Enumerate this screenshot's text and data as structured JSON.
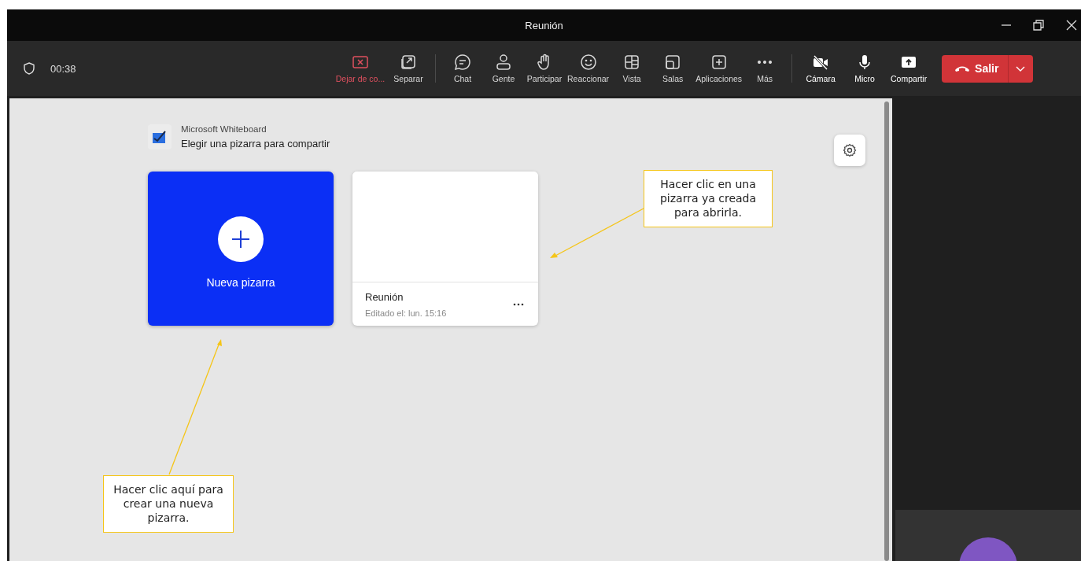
{
  "window": {
    "title": "Reunión"
  },
  "meeting_bar": {
    "timer": "00:38",
    "actions": [
      {
        "label": "Dejar de co...",
        "kind": "stop"
      },
      {
        "label": "Separar",
        "kind": "normal"
      },
      {
        "label": "Chat",
        "kind": "normal"
      },
      {
        "label": "Gente",
        "kind": "normal"
      },
      {
        "label": "Participar",
        "kind": "normal"
      },
      {
        "label": "Reaccionar",
        "kind": "normal"
      },
      {
        "label": "Vista",
        "kind": "normal"
      },
      {
        "label": "Salas",
        "kind": "normal"
      },
      {
        "label": "Aplicaciones",
        "kind": "normal"
      },
      {
        "label": "Más",
        "kind": "normal"
      }
    ],
    "devices": [
      {
        "label": "Cámara",
        "on": false
      },
      {
        "label": "Micro",
        "on": true
      },
      {
        "label": "Compartir"
      }
    ],
    "leave_button": {
      "label": "Salir"
    }
  },
  "whiteboard_picker": {
    "app_name": "Microsoft Whiteboard",
    "heading": "Elegir una pizarra para compartir",
    "new_board": {
      "label": "Nueva pizarra"
    },
    "boards": [
      {
        "title": "Reunión",
        "edited": "Editado el: lun. 15:16"
      }
    ]
  },
  "annotations": [
    {
      "text": "Hacer clic en una pizarra ya creada para abrirla."
    },
    {
      "text": "Hacer clic aquí para crear una nueva pizarra."
    }
  ]
}
